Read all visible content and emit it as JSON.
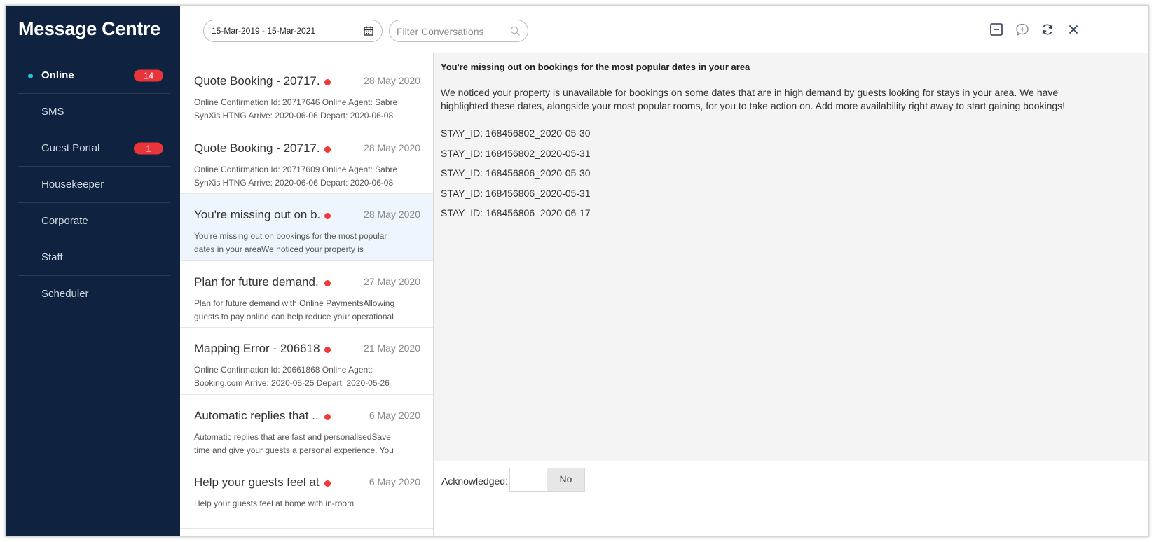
{
  "app": {
    "title": "Message Centre"
  },
  "sidebar": {
    "items": [
      {
        "label": "Online",
        "badge": "14",
        "active": true
      },
      {
        "label": "SMS",
        "badge": ""
      },
      {
        "label": "Guest Portal",
        "badge": "1"
      },
      {
        "label": "Housekeeper",
        "badge": ""
      },
      {
        "label": "Corporate",
        "badge": ""
      },
      {
        "label": "Staff",
        "badge": ""
      },
      {
        "label": "Scheduler",
        "badge": ""
      }
    ]
  },
  "toolbar": {
    "date_range": "15-Mar-2019 - 15-Mar-2021",
    "filter_placeholder": "Filter Conversations",
    "icons": [
      "minimize-icon",
      "new-message-icon",
      "refresh-icon",
      "close-icon"
    ]
  },
  "conversations": [
    {
      "title": "Quote Booking - 20717...",
      "date": "28 May 2020",
      "preview": "Online Confirmation Id: 20717646 Online Agent: Sabre SynXis HTNG Arrive: 2020-06-06 Depart: 2020-06-08",
      "unread": true,
      "selected": false
    },
    {
      "title": "Quote Booking - 20717...",
      "date": "28 May 2020",
      "preview": "Online Confirmation Id: 20717609 Online Agent: Sabre SynXis HTNG Arrive: 2020-06-06 Depart: 2020-06-08",
      "unread": true,
      "selected": false
    },
    {
      "title": "You're missing out on b...",
      "date": "28 May 2020",
      "preview": "You're missing out on bookings for the most popular dates in your areaWe noticed your property is unavailable for",
      "unread": true,
      "selected": true
    },
    {
      "title": "Plan for future demand...",
      "date": "27 May 2020",
      "preview": "Plan for future demand with Online PaymentsAllowing guests to pay online can help reduce your operational",
      "unread": true,
      "selected": false
    },
    {
      "title": "Mapping Error - 206618...",
      "date": "21 May 2020",
      "preview": "Online Confirmation Id: 20661868 Online Agent: Booking.com Arrive: 2020-05-25 Depart: 2020-05-26",
      "unread": true,
      "selected": false
    },
    {
      "title": "Automatic replies that ...",
      "date": "6 May 2020",
      "preview": "Automatic replies that are fast and personalisedSave time and give your guests a personal experience. You can attach",
      "unread": true,
      "selected": false
    },
    {
      "title": "Help your guests feel at...",
      "date": "6 May 2020",
      "preview": "Help your guests feel at home with in-room",
      "unread": true,
      "selected": false
    }
  ],
  "detail": {
    "heading": "You're missing out on bookings for the most popular dates in your area",
    "body": "We noticed your property is unavailable for bookings on some dates that are in high demand by guests looking for stays in your area. We have highlighted these dates, alongside your most popular rooms, for you to take action on. Add more availability right away to start gaining bookings!",
    "stays": [
      "STAY_ID: 168456802_2020-05-30",
      "STAY_ID: 168456802_2020-05-31",
      "STAY_ID: 168456806_2020-05-30",
      "STAY_ID: 168456806_2020-05-31",
      "STAY_ID: 168456806_2020-06-17"
    ]
  },
  "footer": {
    "ack_label": "Acknowledged:",
    "ack_value": "No"
  },
  "colors": {
    "sidebar_bg": "#0f2340",
    "badge": "#e8343a",
    "online_dot": "#27c4c9",
    "unread_dot": "#ee3a3a",
    "selected_row": "#eef5fc"
  }
}
